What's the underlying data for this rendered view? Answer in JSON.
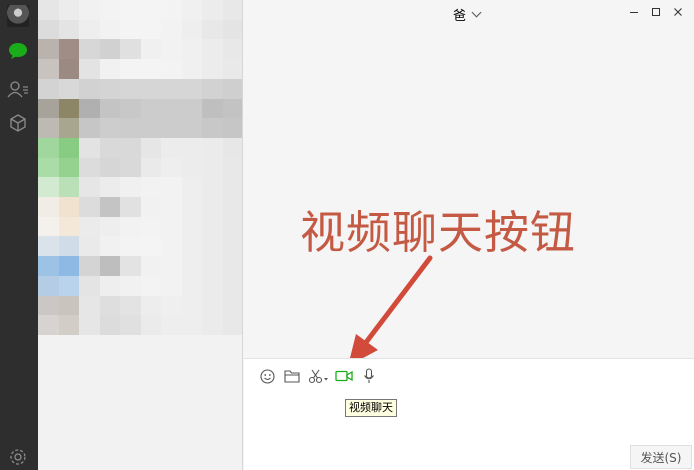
{
  "sidebar": {
    "icons": [
      "avatar",
      "chat-icon",
      "contacts-icon",
      "favorites-icon",
      "settings-icon"
    ],
    "active_color": "#1aad19"
  },
  "chat": {
    "title": "爸",
    "annotation": "视频聊天按钮",
    "annotation_color": "#c45a44",
    "toolbar_icons": [
      "emoji-icon",
      "folder-icon",
      "scissors-icon",
      "video-call-icon",
      "microphone-icon"
    ],
    "tooltip": "视频聊天",
    "send_label": "发送(S)"
  }
}
